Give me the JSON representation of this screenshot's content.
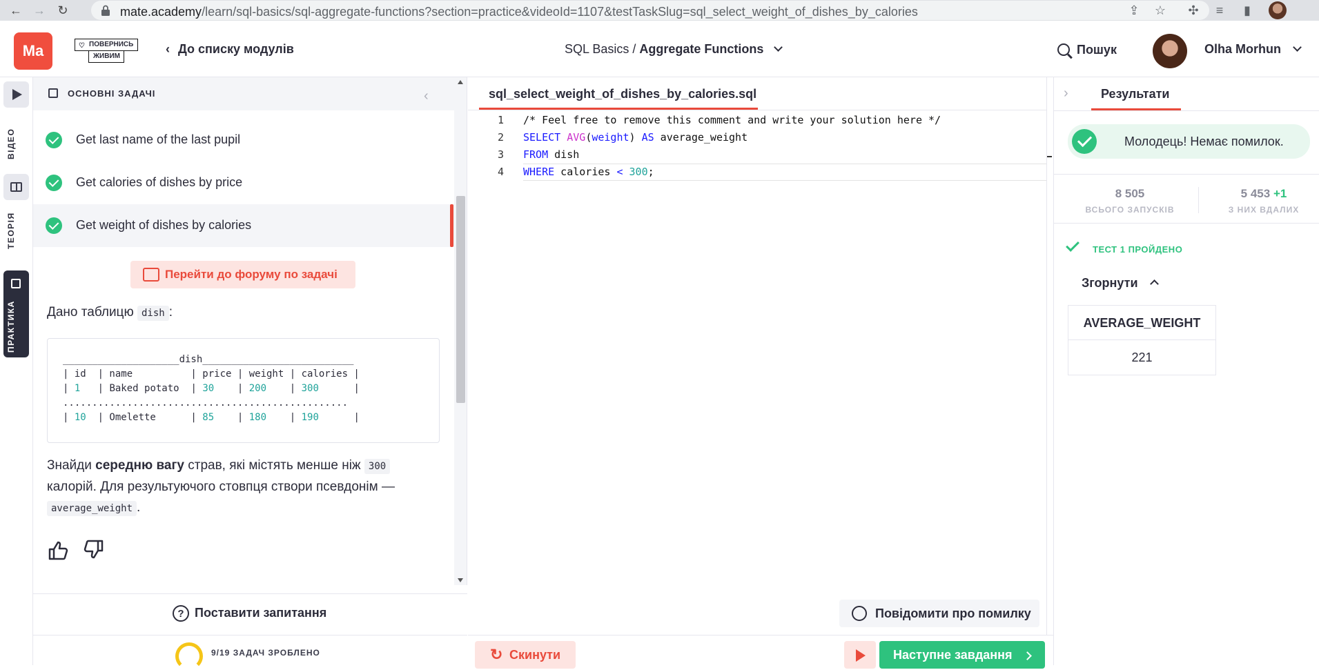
{
  "browser": {
    "url_host": "mate.academy",
    "url_path": "/learn/sql-basics/sql-aggregate-functions?section=practice&videoId=1107&testTaskSlug=sql_select_weight_of_dishes_by_calories"
  },
  "header": {
    "logo": "Ma",
    "promo_line1": "ПОВЕРНИСЬ",
    "promo_line2": "ЖИВИМ",
    "back_link": "До списку модулів",
    "course": "SQL Basics",
    "separator": " / ",
    "topic": "Aggregate Functions",
    "search": "Пошук",
    "user_name": "Olha Morhun"
  },
  "vtabs": {
    "video": "ВІДЕО",
    "theory": "ТЕОРІЯ",
    "practice": "ПРАКТИКА"
  },
  "task_panel": {
    "title": "ОСНОВНІ ЗАДАЧІ",
    "tasks": [
      {
        "label": "Get last name of the last pupil"
      },
      {
        "label": "Get calories of dishes by price"
      },
      {
        "label": "Get weight of dishes by calories"
      }
    ],
    "forum_button": "Перейти до форуму по задачі",
    "given_text": "Дано таблицю",
    "given_table_name": "dish",
    "given_colon": ":",
    "task_text_1": "Знайди",
    "task_text_bold": "середню вагу",
    "task_text_2": "страв, які містять менше ніж",
    "task_code_300": "300",
    "task_text_3": "калорій. Для результуючого стовпця створи псевдонім —",
    "task_alias": "average_weight",
    "task_end": ".",
    "ask_question": "Поставити запитання",
    "progress_label": "9/19 ЗАДАЧ ЗРОБЛЕНО"
  },
  "editor": {
    "file_tab": "sql_select_weight_of_dishes_by_calories.sql",
    "line_numbers": [
      "1",
      "2",
      "3",
      "4"
    ],
    "report_button": "Повідомити про помилку",
    "reset_button": "Скинути",
    "next_button": "Наступне завдання"
  },
  "results": {
    "tab": "Результати",
    "success_message": "Молодець! Немає помилок.",
    "stat_runs_value": "8 505",
    "stat_runs_label": "ВСЬОГО ЗАПУСКІВ",
    "stat_success_value": "5 453",
    "stat_success_plus": "+1",
    "stat_success_label": "З НИХ ВДАЛИХ",
    "test_passed": "ТЕСТ 1 ПРОЙДЕНО",
    "collapse": "Згорнути",
    "table_header": "AVERAGE_WEIGHT",
    "table_value": "221"
  },
  "colors": {
    "brand_red": "#f04e3e",
    "success_green": "#2ec27e"
  }
}
